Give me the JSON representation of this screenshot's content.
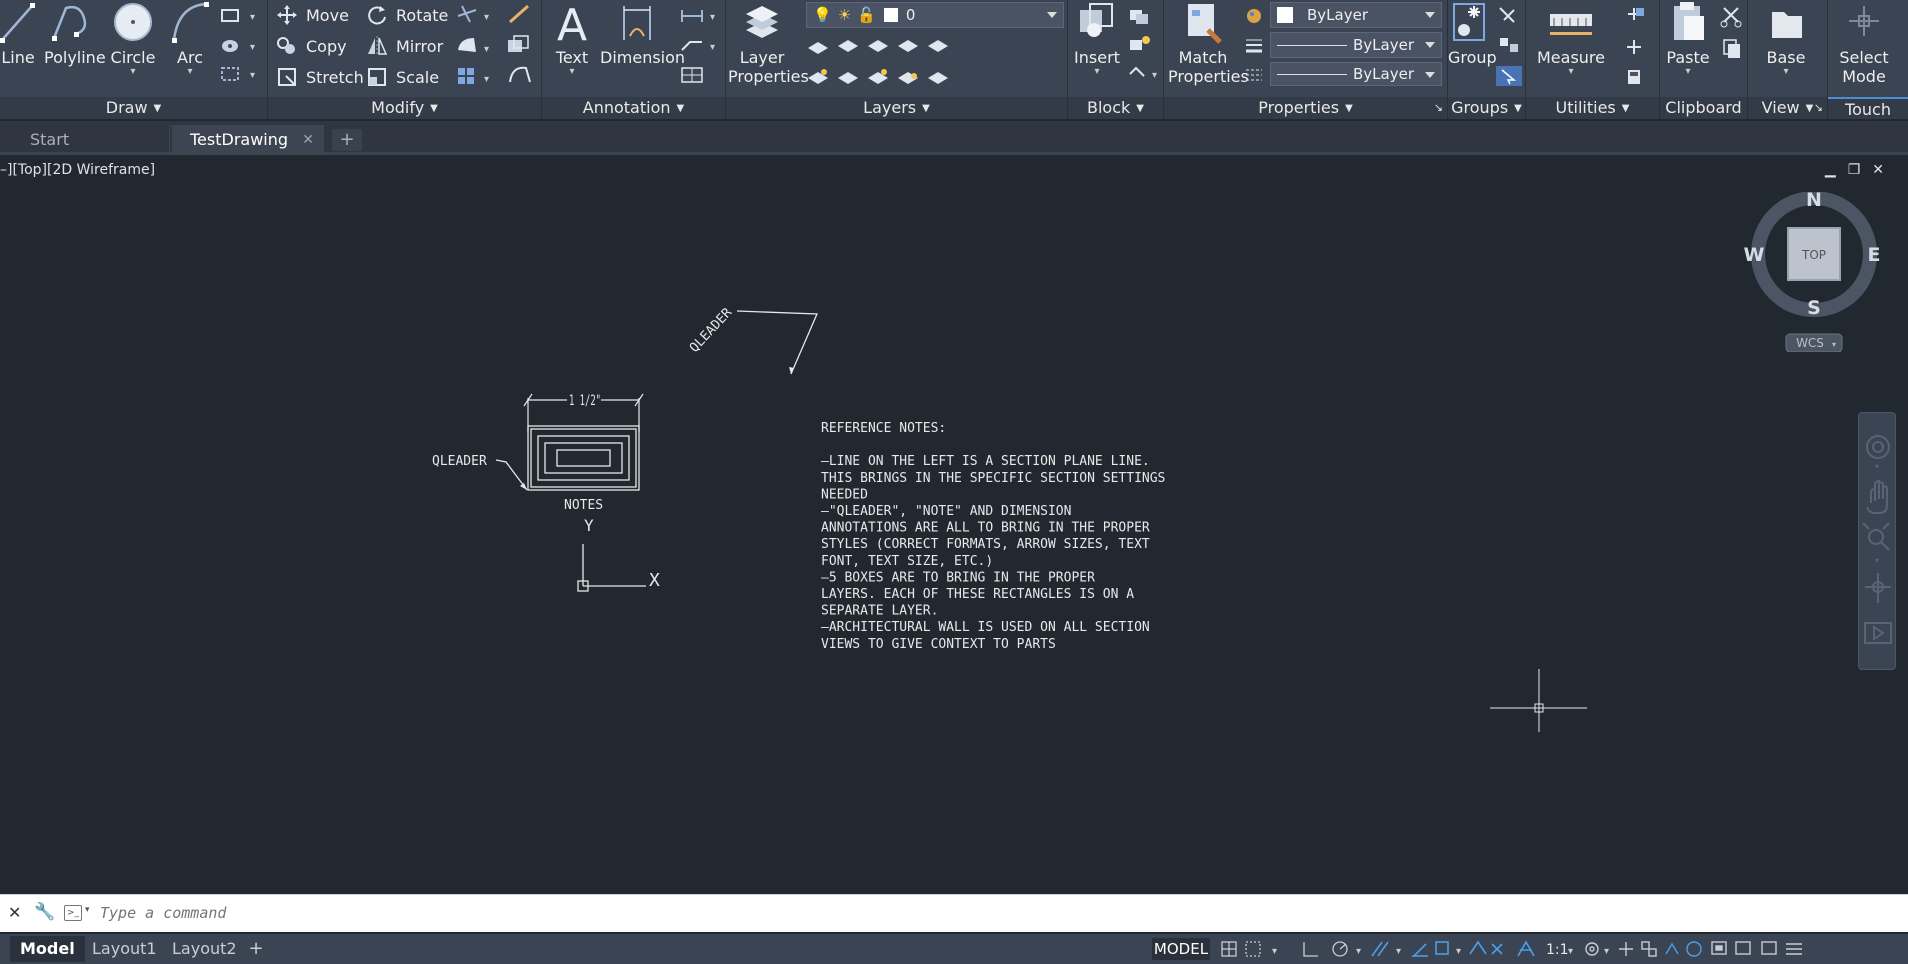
{
  "ribbon": {
    "draw": {
      "title": "Draw",
      "line": "Line",
      "polyline": "Polyline",
      "circle": "Circle",
      "arc": "Arc"
    },
    "modify": {
      "title": "Modify",
      "move": "Move",
      "rotate": "Rotate",
      "copy": "Copy",
      "mirror": "Mirror",
      "stretch": "Stretch",
      "scale": "Scale"
    },
    "annotation": {
      "title": "Annotation",
      "text": "Text",
      "dimension": "Dimension"
    },
    "layers": {
      "title": "Layers",
      "layer_properties_1": "Layer",
      "layer_properties_2": "Properties",
      "current_layer": "0"
    },
    "block": {
      "title": "Block",
      "insert": "Insert"
    },
    "properties": {
      "title": "Properties",
      "match_1": "Match",
      "match_2": "Properties",
      "color": "ByLayer",
      "linetype": "ByLayer",
      "lineweight": "ByLayer"
    },
    "groups": {
      "title": "Groups",
      "group": "Group"
    },
    "utilities": {
      "title": "Utilities",
      "measure": "Measure"
    },
    "clipboard": {
      "title": "Clipboard",
      "paste": "Paste"
    },
    "view": {
      "title": "View",
      "base": "Base"
    },
    "touch": {
      "title": "Touch",
      "select_mode_1": "Select",
      "select_mode_2": "Mode"
    }
  },
  "tabs": {
    "start": "Start",
    "drawing": "TestDrawing"
  },
  "viewport": {
    "label": "–][Top][2D Wireframe]",
    "viewcube": {
      "top": "TOP",
      "n": "N",
      "s": "S",
      "e": "E",
      "w": "W",
      "wcs": "WCS"
    }
  },
  "drawing": {
    "qleader_top": "QLEADER",
    "qleader_left": "QLEADER",
    "dimension": "1 1/2\"",
    "notes_label": "NOTES",
    "ucs_x": "X",
    "ucs_y": "Y",
    "reference_notes": [
      "REFERENCE NOTES:",
      "",
      "–LINE ON THE LEFT IS A SECTION PLANE LINE.",
      "THIS BRINGS IN THE SPECIFIC SECTION SETTINGS",
      "NEEDED",
      "–\"QLEADER\", \"NOTE\" AND DIMENSION",
      "ANNOTATIONS ARE ALL TO BRING IN THE PROPER",
      "STYLES (CORRECT FORMATS, ARROW SIZES, TEXT",
      "FONT, TEXT SIZE, ETC.)",
      "–5 BOXES ARE TO BRING IN THE PROPER",
      "LAYERS.  EACH OF THESE RECTANGLES IS ON A",
      "SEPARATE LAYER.",
      "–ARCHITECTURAL WALL IS USED ON ALL SECTION",
      "VIEWS TO GIVE CONTEXT TO PARTS"
    ]
  },
  "command": {
    "placeholder": "Type a command"
  },
  "status": {
    "model_tab": "Model",
    "layout1": "Layout1",
    "layout2": "Layout2",
    "model_label": "MODEL",
    "scale": "1:1"
  }
}
